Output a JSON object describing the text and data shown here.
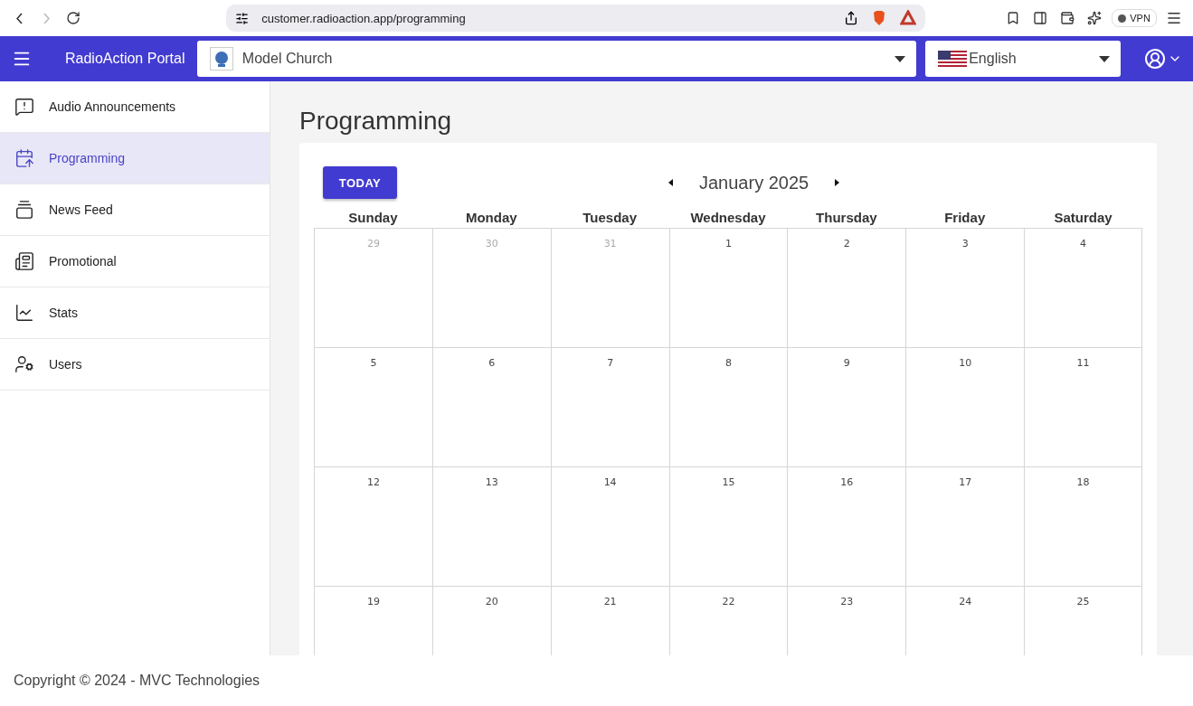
{
  "browser": {
    "url": "customer.radioaction.app/programming",
    "vpn_label": "VPN"
  },
  "app_bar": {
    "title": "RadioAction Portal",
    "organization": "Model Church",
    "language": "English"
  },
  "sidebar": {
    "items": [
      {
        "label": "Audio Announcements",
        "kind": "announce",
        "selected": false
      },
      {
        "label": "Programming",
        "kind": "calendar",
        "selected": true
      },
      {
        "label": "News Feed",
        "kind": "feed",
        "selected": false
      },
      {
        "label": "Promotional",
        "kind": "promo",
        "selected": false
      },
      {
        "label": "Stats",
        "kind": "stats",
        "selected": false
      },
      {
        "label": "Users",
        "kind": "users",
        "selected": false
      }
    ]
  },
  "page": {
    "title": "Programming"
  },
  "calendar": {
    "today_button": "TODAY",
    "month": "January 2025",
    "weekdays": [
      "Sunday",
      "Monday",
      "Tuesday",
      "Wednesday",
      "Thursday",
      "Friday",
      "Saturday"
    ],
    "weeks": [
      [
        {
          "day": "29",
          "outside": true
        },
        {
          "day": "30",
          "outside": true
        },
        {
          "day": "31",
          "outside": true
        },
        {
          "day": "1",
          "outside": false
        },
        {
          "day": "2",
          "outside": false
        },
        {
          "day": "3",
          "outside": false
        },
        {
          "day": "4",
          "outside": false
        }
      ],
      [
        {
          "day": "5",
          "outside": false
        },
        {
          "day": "6",
          "outside": false
        },
        {
          "day": "7",
          "outside": false
        },
        {
          "day": "8",
          "outside": false
        },
        {
          "day": "9",
          "outside": false
        },
        {
          "day": "10",
          "outside": false
        },
        {
          "day": "11",
          "outside": false
        }
      ],
      [
        {
          "day": "12",
          "outside": false
        },
        {
          "day": "13",
          "outside": false
        },
        {
          "day": "14",
          "outside": false
        },
        {
          "day": "15",
          "outside": false
        },
        {
          "day": "16",
          "outside": false
        },
        {
          "day": "17",
          "outside": false
        },
        {
          "day": "18",
          "outside": false
        }
      ],
      [
        {
          "day": "19",
          "outside": false
        },
        {
          "day": "20",
          "outside": false
        },
        {
          "day": "21",
          "outside": false
        },
        {
          "day": "22",
          "outside": false
        },
        {
          "day": "23",
          "outside": false
        },
        {
          "day": "24",
          "outside": false
        },
        {
          "day": "25",
          "outside": false
        }
      ]
    ]
  },
  "footer": {
    "text": "Copyright © 2024 - MVC Technologies"
  }
}
